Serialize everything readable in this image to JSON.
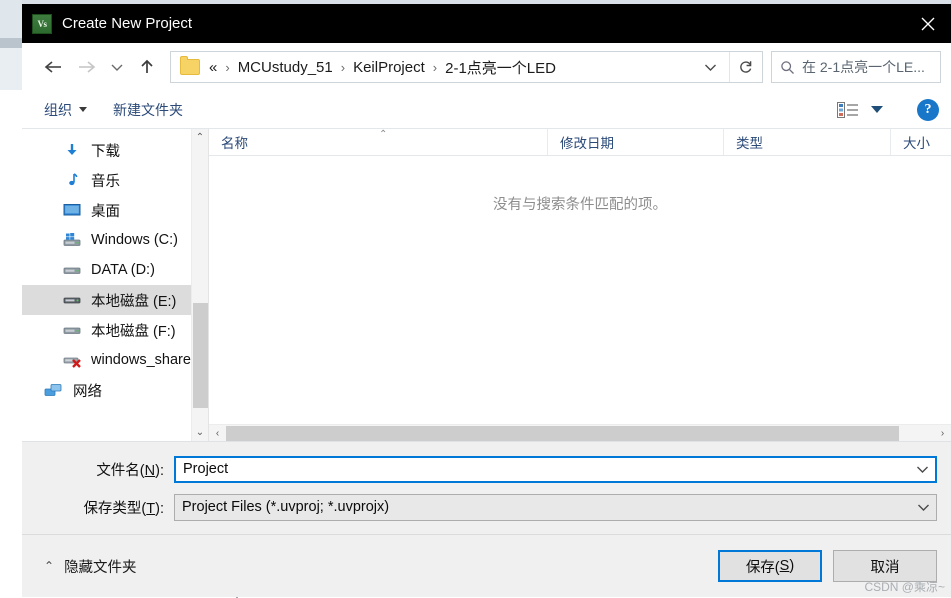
{
  "window": {
    "title": "Create New Project",
    "icon_label": "Vs",
    "close_label": "✕"
  },
  "nav": {
    "back_icon": "arrow-left",
    "forward_icon": "arrow-right",
    "recent_icon": "chevron-down",
    "up_icon": "arrow-up",
    "breadcrumb_prefix": "«",
    "breadcrumb": [
      "MCUstudy_51",
      "KeilProject",
      "2-1点亮一个LED"
    ],
    "separator": "›",
    "dropdown_icon": "chevron-down",
    "refresh_icon": "refresh",
    "search_placeholder": "在 2-1点亮一个LE..."
  },
  "toolbar": {
    "organize_label": "组织",
    "new_folder_label": "新建文件夹",
    "view_icon": "list-view-icon",
    "help_label": "?"
  },
  "sidebar": {
    "items": [
      {
        "label": "下载",
        "icon": "download-arrow-icon",
        "selected": false,
        "indent": true
      },
      {
        "label": "音乐",
        "icon": "music-note-icon",
        "selected": false,
        "indent": true
      },
      {
        "label": "桌面",
        "icon": "desktop-icon",
        "selected": false,
        "indent": true
      },
      {
        "label": "Windows (C:)",
        "icon": "windows-drive-icon",
        "selected": false,
        "indent": true
      },
      {
        "label": "DATA (D:)",
        "icon": "drive-icon",
        "selected": false,
        "indent": true
      },
      {
        "label": "本地磁盘 (E:)",
        "icon": "drive-icon",
        "selected": true,
        "indent": true
      },
      {
        "label": "本地磁盘 (F:)",
        "icon": "drive-icon",
        "selected": false,
        "indent": true
      },
      {
        "label": "windows_share",
        "icon": "disconnected-network-drive-icon",
        "selected": false,
        "indent": true
      },
      {
        "label": "网络",
        "icon": "network-icon",
        "selected": false,
        "indent": false
      }
    ],
    "scroll_up_icon": "⌃",
    "scroll_down_icon": "⌄"
  },
  "file_list": {
    "columns": [
      {
        "label": "名称",
        "sorted": true,
        "sort_icon": "⌃"
      },
      {
        "label": "修改日期",
        "sorted": false,
        "sort_icon": ""
      },
      {
        "label": "类型",
        "sorted": false,
        "sort_icon": ""
      },
      {
        "label": "大小",
        "sorted": false,
        "sort_icon": ""
      }
    ],
    "empty_message": "没有与搜索条件匹配的项。",
    "scroll_left_icon": "‹",
    "scroll_right_icon": "›"
  },
  "form": {
    "filename_label_pre": "文件名(",
    "filename_label_key": "N",
    "filename_label_post": "):",
    "filename_value": "Project",
    "filetype_label_pre": "保存类型(",
    "filetype_label_key": "T",
    "filetype_label_post": "):",
    "filetype_value": "Project Files (*.uvproj; *.uvprojx)",
    "combo_arrow_icon": "chevron-down"
  },
  "footer": {
    "hide_folders_label": "隐藏文件夹",
    "hide_folders_caret": "⌃",
    "save_label_pre": "保存(",
    "save_label_key": "S",
    "save_label_post": ")",
    "cancel_label": "取消",
    "watermark": "CSDN @乘凉~"
  },
  "colors": {
    "accent": "#0078d7",
    "titlebar": "#000000",
    "dialog_bg": "#f0f0f0",
    "selection": "#dcdcdc",
    "link_blue": "#2b4a78"
  }
}
